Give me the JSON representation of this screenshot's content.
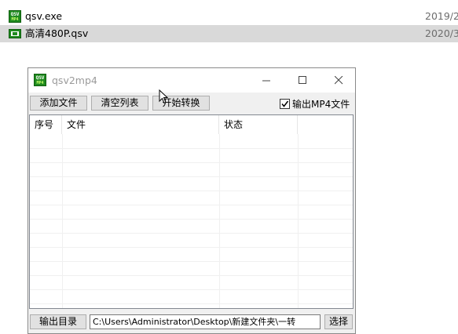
{
  "explorer": {
    "files": [
      {
        "name": "qsv.exe",
        "date": "2019/2,",
        "icon": "qsv-exe-icon",
        "selected": false
      },
      {
        "name": "高清480P.qsv",
        "date": "2020/3,",
        "icon": "qsv-video-icon",
        "selected": true
      }
    ]
  },
  "window": {
    "title": "qsv2mp4",
    "icon_text": "QSV",
    "icon_sub": "MP4",
    "minimize_glyph": "—",
    "maximize_glyph": "☐",
    "close_glyph": "✕"
  },
  "toolbar": {
    "add_file": "添加文件",
    "clear_list": "清空列表",
    "start_convert": "开始转换",
    "output_mp4_label": "输出MP4文件",
    "output_mp4_checked": true
  },
  "list": {
    "columns": [
      "序号",
      "文件",
      "状态"
    ]
  },
  "bottom": {
    "output_dir_label": "输出目录",
    "output_path": "C:\\Users\\Administrator\\Desktop\\新建文件夹\\一转",
    "choose_label": "选择"
  },
  "colors": {
    "selection": "#d9d9d9",
    "icon_green": "#1f8a1f"
  }
}
